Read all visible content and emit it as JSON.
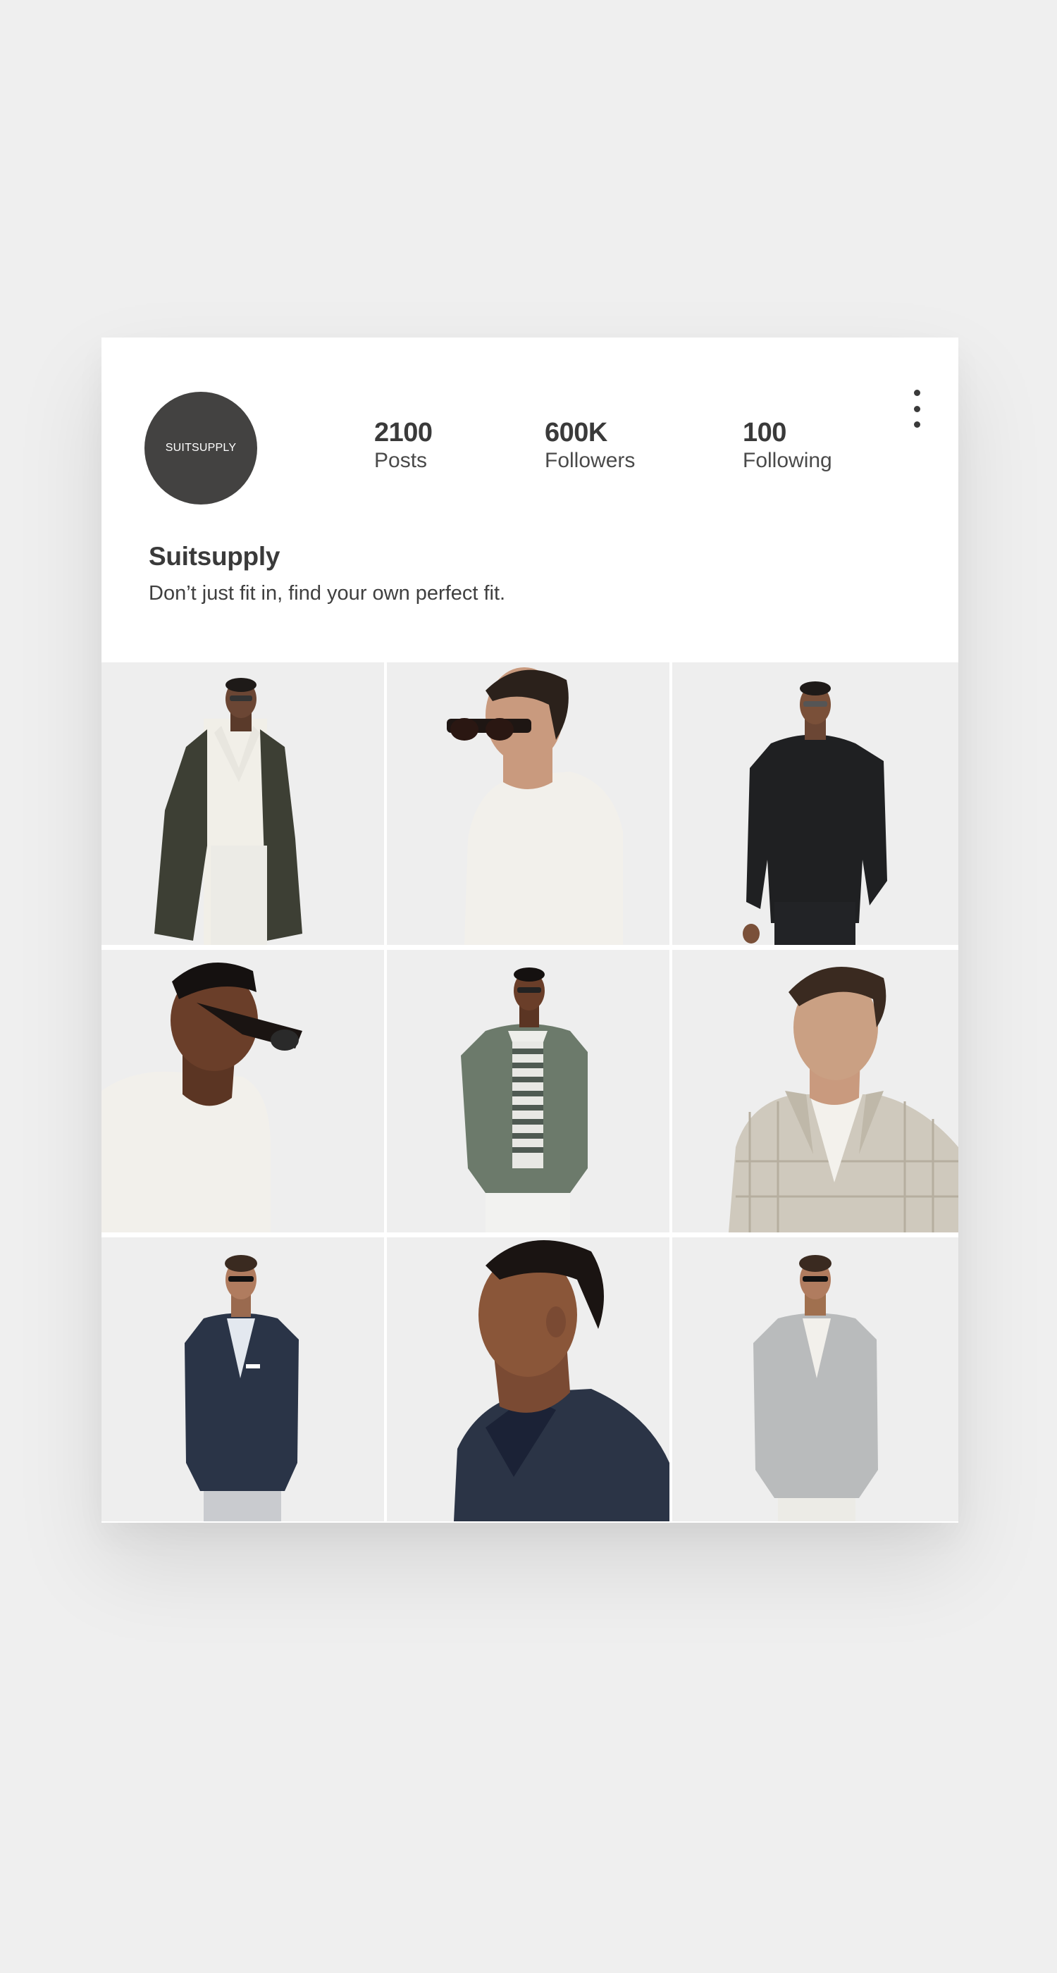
{
  "profile": {
    "avatar_text": "SUITSUPPLY",
    "name": "Suitsupply",
    "bio": "Don’t just fit in, find your own perfect fit."
  },
  "stats": {
    "posts": {
      "value": "2100",
      "label": "Posts"
    },
    "followers": {
      "value": "600K",
      "label": "Followers"
    },
    "following": {
      "value": "100",
      "label": "Following"
    }
  },
  "menu": {
    "icon": "more-vertical-icon"
  },
  "grid": {
    "items": [
      {
        "description_icon": "photo-model-overcoat"
      },
      {
        "description_icon": "photo-model-polo-profile"
      },
      {
        "description_icon": "photo-model-black-jacket"
      },
      {
        "description_icon": "photo-model-white-shirt-sunglasses"
      },
      {
        "description_icon": "photo-model-green-blazer"
      },
      {
        "description_icon": "photo-model-plaid-coat"
      },
      {
        "description_icon": "photo-model-navy-blazer"
      },
      {
        "description_icon": "photo-model-navy-jacket-profile"
      },
      {
        "description_icon": "photo-model-grey-suit"
      }
    ]
  },
  "colors": {
    "background": "#efefef",
    "card": "#ffffff",
    "text": "#3a3a3a",
    "avatar": "#434241",
    "tile": "#eeeeee"
  }
}
